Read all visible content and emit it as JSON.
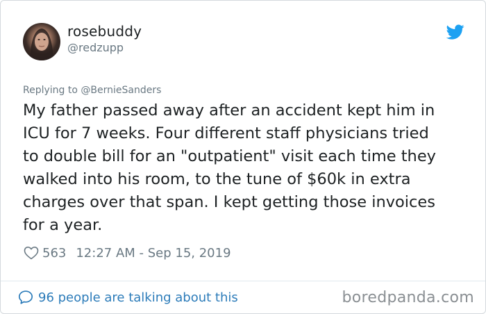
{
  "tweet": {
    "display_name": "rosebuddy",
    "handle": "@redzupp",
    "replying_to": "Replying to @BernieSanders",
    "text": "My father passed away after an accident kept him in\nICU for 7 weeks. Four different staff physicians tried\nto double bill for an \"outpatient\" visit each time they\nwalked into his room, to the tune of $60k in extra\ncharges over that span. I kept getting those invoices\nfor a year.",
    "likes": "563",
    "timestamp": "12:27 AM - Sep 15, 2019",
    "conversation": "96 people are talking about this"
  },
  "watermark": "boredpanda.com",
  "icons": {
    "platform": "twitter-bird-icon",
    "like": "heart-icon",
    "conversation": "comment-icon"
  },
  "colors": {
    "twitter_blue": "#1da1f2",
    "link_blue": "#2b7bb9",
    "muted_gray": "#697882",
    "text": "#1c2022"
  }
}
